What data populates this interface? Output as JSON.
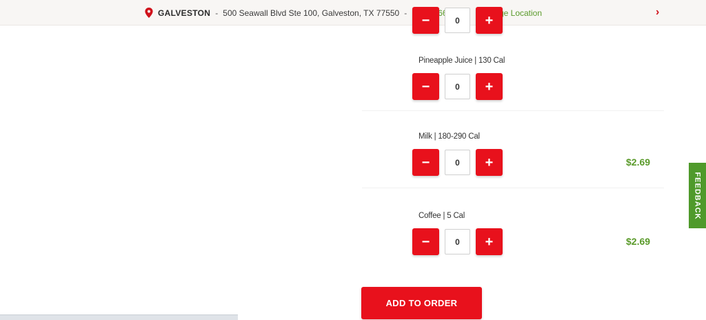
{
  "location_bar": {
    "icon": "map-pin-icon",
    "city": "GALVESTON",
    "separator": "-",
    "address": "500 Seawall Blvd Ste 100, Galveston, TX 77550",
    "phone": "(409) 766-1690",
    "change_location": "Change Location",
    "chevron": "›"
  },
  "colors": {
    "brand_red": "#e8111c",
    "accent_green": "#5a9a2a"
  },
  "items": [
    {
      "label": "",
      "quantity": "0",
      "minus": "−",
      "plus": "+",
      "price": ""
    },
    {
      "label": "Pineapple Juice | 130 Cal",
      "quantity": "0",
      "minus": "−",
      "plus": "+",
      "price": ""
    },
    {
      "label": "Milk | 180-290 Cal",
      "quantity": "0",
      "minus": "−",
      "plus": "+",
      "price": "$2.69"
    },
    {
      "label": "Coffee | 5 Cal",
      "quantity": "0",
      "minus": "−",
      "plus": "+",
      "price": "$2.69"
    }
  ],
  "add_to_order": "ADD TO ORDER",
  "feedback": "FEEDBACK"
}
